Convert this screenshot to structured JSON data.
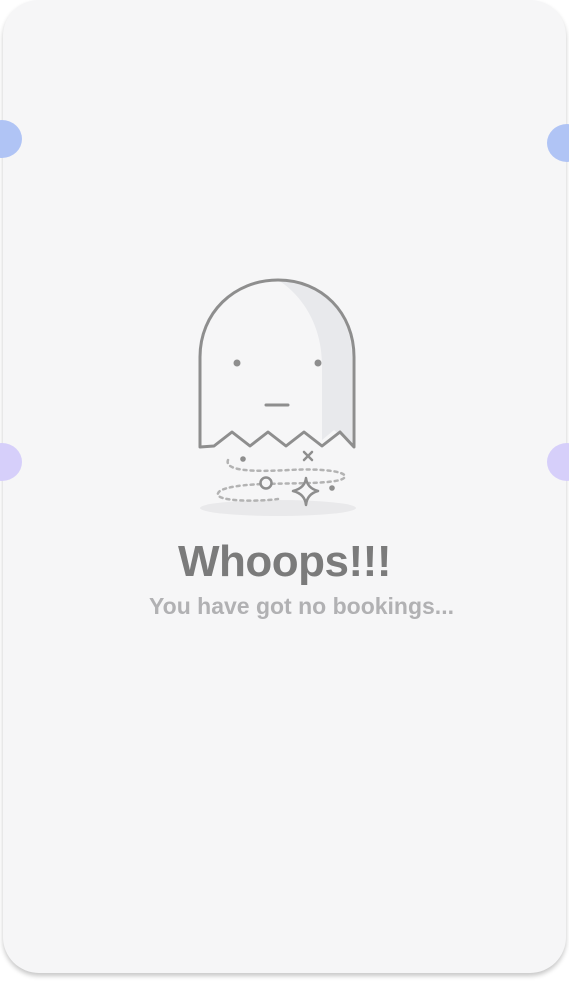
{
  "empty_state": {
    "title": "Whoops!!!",
    "message": "You have got no bookings...",
    "illustration": "ghost-icon"
  },
  "colors": {
    "card_background": "#f6f6f7",
    "title": "#7b7b7b",
    "message": "#b1b1b3",
    "tab_blue": "#b0c4f5",
    "tab_purple": "#d6cffa",
    "ghost_outline": "#8e8e8e",
    "ghost_shade": "#e8e9ec"
  }
}
